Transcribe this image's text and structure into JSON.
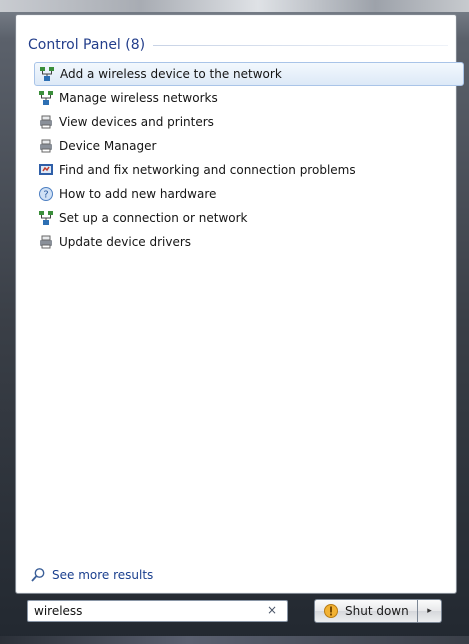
{
  "start_menu": {
    "section": {
      "title": "Control Panel (8)"
    },
    "results": [
      {
        "label": "Add a wireless device to the network",
        "icon": "network-icon",
        "selected": true
      },
      {
        "label": "Manage wireless networks",
        "icon": "network-icon",
        "selected": false
      },
      {
        "label": "View devices and printers",
        "icon": "devices-printers-icon",
        "selected": false
      },
      {
        "label": "Device Manager",
        "icon": "devices-printers-icon",
        "selected": false
      },
      {
        "label": "Find and fix networking and connection problems",
        "icon": "troubleshoot-icon",
        "selected": false
      },
      {
        "label": "How to add new hardware",
        "icon": "help-icon",
        "selected": false
      },
      {
        "label": "Set up a connection or network",
        "icon": "network-icon",
        "selected": false
      },
      {
        "label": "Update device drivers",
        "icon": "devices-printers-icon",
        "selected": false
      }
    ],
    "see_more": {
      "label": "See more results",
      "icon": "search-icon"
    },
    "search": {
      "value": "wireless",
      "clear_glyph": "×"
    },
    "shutdown": {
      "label": "Shut down",
      "icon": "shield-icon",
      "arrow_glyph": "▸"
    }
  },
  "colors": {
    "header_text": "#233e8b",
    "link_text": "#1a3f8e",
    "selection_fill": "#dde9f7",
    "selection_border": "#a9c4e8"
  }
}
